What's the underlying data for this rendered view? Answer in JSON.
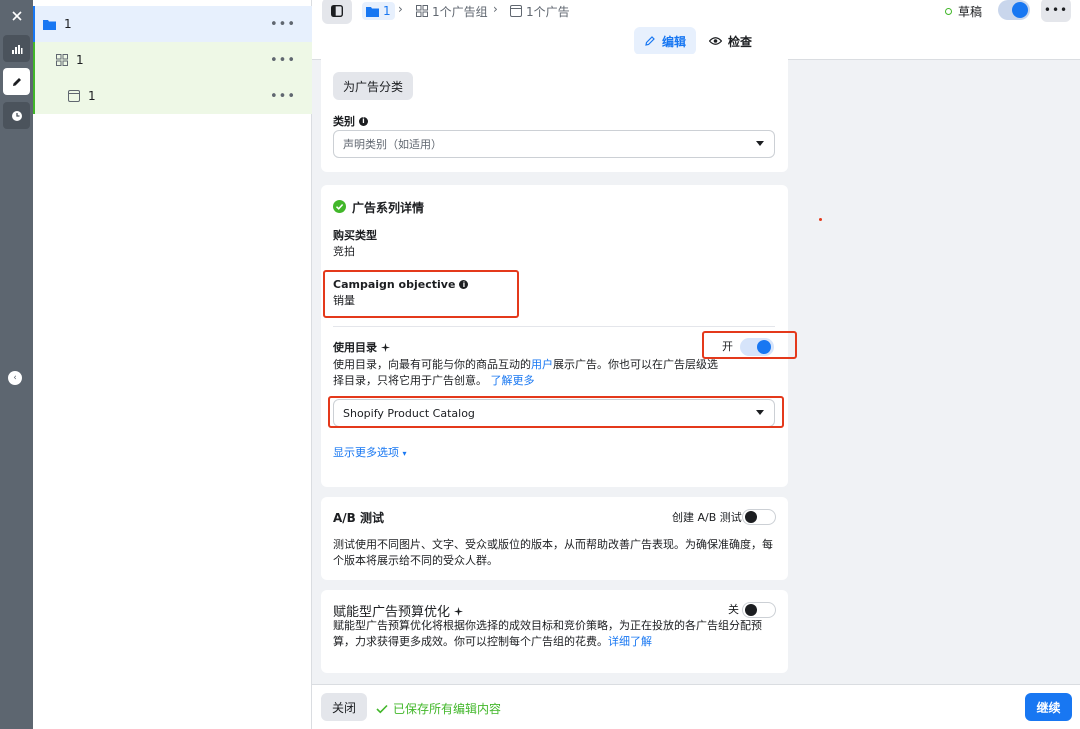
{
  "tree": {
    "items": [
      {
        "label": "1",
        "icon": "folder-icon"
      },
      {
        "label": "1",
        "icon": "grid-icon"
      },
      {
        "label": "1",
        "icon": "ad-icon"
      }
    ],
    "more": "•••"
  },
  "header": {
    "breadcrumb": [
      {
        "label": "1"
      },
      {
        "label": "1个广告组"
      },
      {
        "label": "1个广告"
      }
    ],
    "status": "草稿",
    "more": "•••",
    "tabs": {
      "edit": "编辑",
      "review": "检查"
    }
  },
  "card_category": {
    "button": "为广告分类",
    "field_label": "类别",
    "placeholder": "声明类别（如适用）"
  },
  "card_campaign": {
    "title": "广告系列详情",
    "purchase_type_label": "购买类型",
    "purchase_type_value": "竞拍",
    "objective_label": "Campaign objective",
    "objective_value": "销量",
    "catalog_label": "使用目录",
    "catalog_desc_1": "使用目录，向最有可能与你的商品互动的",
    "catalog_desc_user": "用户",
    "catalog_desc_2": "展示广告。你也可以在广告层级选择目录，只将它用于广告创意。",
    "learn_more": "了解更多",
    "toggle_label": "开",
    "catalog_select": "Shopify Product Catalog",
    "show_more": "显示更多选项"
  },
  "card_ab": {
    "title": "A/B 测试",
    "toggle_label": "创建 A/B 测试",
    "desc": "测试使用不同图片、文字、受众或版位的版本，从而帮助改善广告表现。为确保准确度，每个版本将展示给不同的受众人群。"
  },
  "card_budget": {
    "title": "赋能型广告预算优化",
    "toggle_label": "关",
    "desc": "赋能型广告预算优化将根据你选择的成效目标和竞价策略，为正在投放的各广告组分配预算，力求获得更多成效。你可以控制每个广告组的花费。",
    "learn_more": "详细了解"
  },
  "footer": {
    "close": "关闭",
    "saved": "已保存所有编辑内容",
    "continue": "继续"
  },
  "colors": {
    "accent": "#1877f2",
    "success": "#42b72a",
    "highlight": "#e4391b"
  }
}
